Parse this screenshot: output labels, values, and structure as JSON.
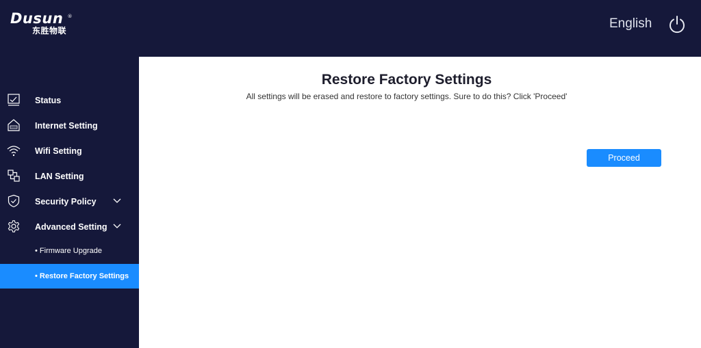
{
  "brand": {
    "name": "Dusun",
    "registered": "®",
    "subtitle": "东胜物联"
  },
  "header": {
    "language": "English",
    "power_icon": "power-icon"
  },
  "sidebar": {
    "items": [
      {
        "label": "Status",
        "icon": "monitor-check-icon"
      },
      {
        "label": "Internet Setting",
        "icon": "house-www-icon"
      },
      {
        "label": "Wifi Setting",
        "icon": "wifi-icon"
      },
      {
        "label": "LAN Setting",
        "icon": "lan-icon"
      },
      {
        "label": "Security Policy",
        "icon": "shield-check-icon",
        "expandable": true
      },
      {
        "label": "Advanced Setting",
        "icon": "gear-icon",
        "expandable": true
      }
    ],
    "subitems": [
      {
        "label": "• Firmware Upgrade",
        "active": false
      },
      {
        "label": "• Restore Factory Settings",
        "active": true
      }
    ]
  },
  "main": {
    "title": "Restore Factory Settings",
    "description": "All settings will be erased and restore to factory settings. Sure to do this? Click 'Proceed'",
    "proceed_label": "Proceed"
  },
  "colors": {
    "navy": "#15183a",
    "accent": "#1a8cff",
    "background": "#ffffff"
  }
}
